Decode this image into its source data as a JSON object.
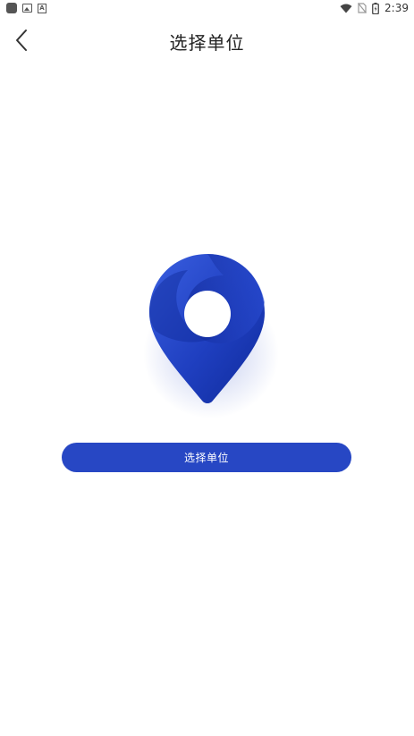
{
  "status_bar": {
    "time": "2:39",
    "icons": [
      "app-square-icon",
      "gallery-icon",
      "font-a-icon",
      "wifi-icon",
      "no-sim-icon",
      "battery-icon"
    ]
  },
  "header": {
    "title": "选择单位",
    "back_icon": "chevron-left-icon"
  },
  "illustration": {
    "icon": "location-pin-icon"
  },
  "primary_button": {
    "label": "选择单位"
  },
  "colors": {
    "accent": "#2747c4",
    "pin_dark": "#0f2a9a",
    "pin_light": "#3a5fe0",
    "background": "#ffffff"
  }
}
